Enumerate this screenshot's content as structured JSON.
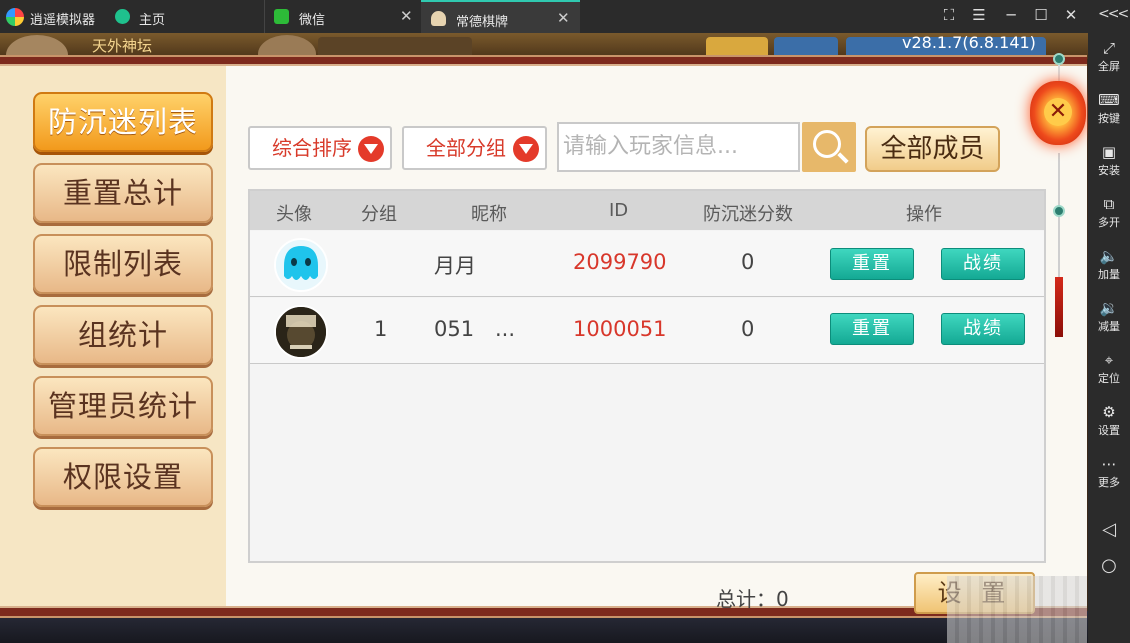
{
  "emulator": {
    "title": "逍遥模拟器",
    "tabs": [
      {
        "label": "主页"
      },
      {
        "label": "微信"
      },
      {
        "label": "常德棋牌"
      }
    ],
    "window_controls": [
      "⛶",
      "☰",
      "─",
      "☐",
      "✕"
    ],
    "collapse": "<<<",
    "sidebar": [
      {
        "label": "全屏",
        "icon": "fullscreen-icon",
        "glyph": "⤢"
      },
      {
        "label": "按键",
        "icon": "keyboard-icon",
        "glyph": "⌨"
      },
      {
        "label": "安装",
        "icon": "apk-icon",
        "glyph": "▣"
      },
      {
        "label": "多开",
        "icon": "multi-window-icon",
        "glyph": "⧉"
      },
      {
        "label": "加量",
        "icon": "volume-up-icon",
        "glyph": "🔈"
      },
      {
        "label": "减量",
        "icon": "volume-down-icon",
        "glyph": "🔉"
      },
      {
        "label": "定位",
        "icon": "location-icon",
        "glyph": "⌖"
      },
      {
        "label": "设置",
        "icon": "gear-icon",
        "glyph": "⚙"
      },
      {
        "label": "更多",
        "icon": "more-icon",
        "glyph": "⋯"
      }
    ],
    "nav": {
      "back": "◁",
      "home": "○"
    }
  },
  "game": {
    "version": "v28.1.7(6.8.141)",
    "background_name": "天外神坛"
  },
  "dialog": {
    "menu": [
      {
        "label": "防沉迷列表",
        "active": true
      },
      {
        "label": "重置总计",
        "active": false
      },
      {
        "label": "限制列表",
        "active": false
      },
      {
        "label": "组统计",
        "active": false
      },
      {
        "label": "管理员统计",
        "active": false
      },
      {
        "label": "权限设置",
        "active": false
      }
    ],
    "sort_dropdown": "综合排序",
    "group_dropdown": "全部分组",
    "search_placeholder": "请输入玩家信息...",
    "members_button": "全部成员",
    "table": {
      "headers": [
        "头像",
        "分组",
        "昵称",
        "ID",
        "防沉迷分数",
        "操作"
      ],
      "rows": [
        {
          "group": "",
          "nickname": "月月",
          "id": "2099790",
          "score": "0",
          "reset": "重置",
          "record": "战绩"
        },
        {
          "group": "1",
          "nickname": "051",
          "nickname_extra": "...",
          "id": "1000051",
          "score": "0",
          "reset": "重置",
          "record": "战绩"
        }
      ]
    },
    "total_label": "总计：0",
    "settings_button": "设 置",
    "close_glyph": "✕"
  }
}
